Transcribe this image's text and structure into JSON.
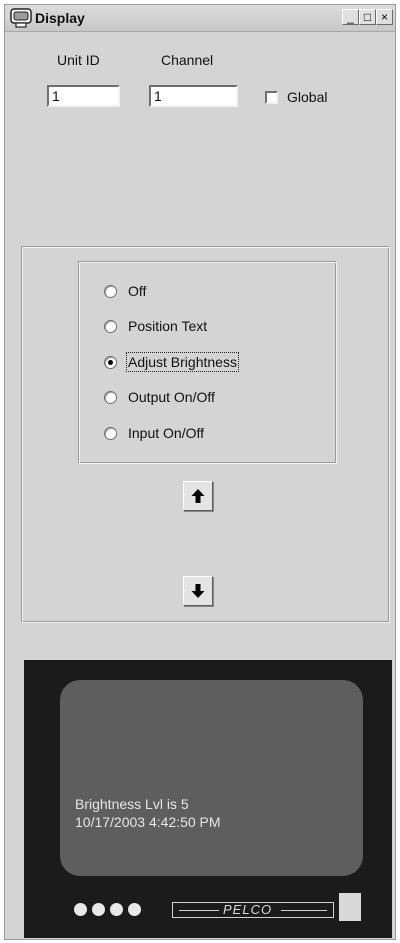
{
  "window": {
    "title": "Display",
    "controls": {
      "minimize": "_",
      "maximize": "□",
      "close": "×"
    }
  },
  "form": {
    "unit_id_label": "Unit ID",
    "unit_id_value": "1",
    "channel_label": "Channel",
    "channel_value": "1",
    "global_label": "Global",
    "global_checked": false
  },
  "modes": {
    "options": [
      {
        "label": "Off",
        "selected": false
      },
      {
        "label": "Position Text",
        "selected": false
      },
      {
        "label": "Adjust Brightness",
        "selected": true
      },
      {
        "label": "Output On/Off",
        "selected": false
      },
      {
        "label": "Input On/Off",
        "selected": false
      }
    ]
  },
  "arrows": {
    "up": "up-arrow-icon",
    "down": "down-arrow-icon"
  },
  "preview": {
    "line1": "Brightness Lvl is 5",
    "line2": "10/17/2003 4:42:50 PM",
    "brand": "PELCO",
    "led_count": 4
  },
  "colors": {
    "window_bg": "#d4d4d4",
    "monitor_bezel": "#1b1b1b",
    "screen": "#5e5e5e",
    "screen_text": "#e6e6e6"
  }
}
